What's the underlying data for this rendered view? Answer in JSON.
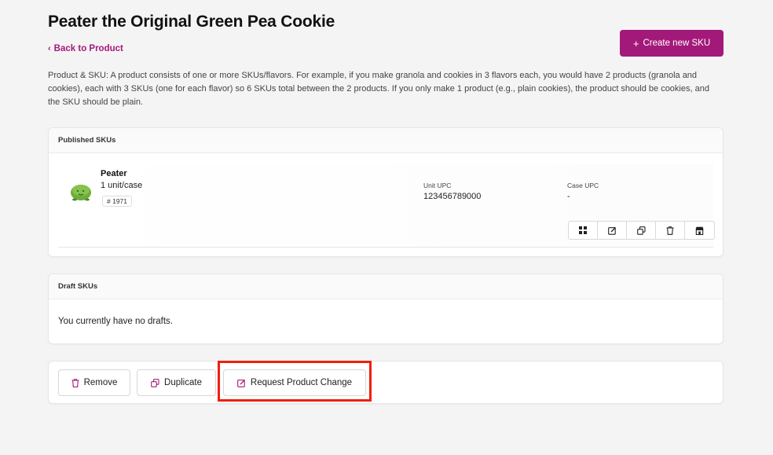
{
  "header": {
    "title": "Peater the Original Green Pea Cookie",
    "back_link": "Back to Product",
    "create_button": "Create new SKU"
  },
  "description": "Product & SKU: A product consists of one or more SKUs/flavors. For example, if you make granola and cookies in 3 flavors each, you would have 2 products (granola and cookies), each with 3 SKUs (one for each flavor) so 6 SKUs total between the 2 products. If you only make 1 product (e.g., plain cookies), the product should be cookies, and the SKU should be plain.",
  "published": {
    "header": "Published SKUs",
    "sku": {
      "name": "Peater",
      "unit": "1 unit/case",
      "number": "# 1971",
      "unit_upc_label": "Unit UPC",
      "unit_upc_value": "123456789000",
      "case_upc_label": "Case UPC",
      "case_upc_value": "-"
    },
    "icons": [
      "grid-icon",
      "edit-icon",
      "duplicate-icon",
      "trash-icon",
      "store-icon"
    ]
  },
  "drafts": {
    "header": "Draft SKUs",
    "empty_text": "You currently have no drafts."
  },
  "actions": {
    "remove": "Remove",
    "duplicate": "Duplicate",
    "request_change": "Request Product Change"
  },
  "colors": {
    "accent": "#a3197a",
    "highlight": "#f01e0a",
    "background": "#f4f4f5"
  }
}
